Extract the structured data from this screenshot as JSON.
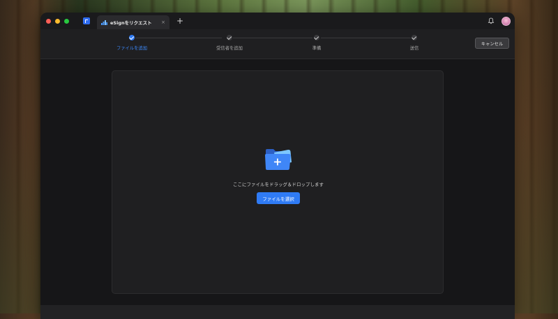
{
  "window": {
    "traffic_lights": [
      "#ff5f57",
      "#febc2e",
      "#28c840"
    ],
    "tab": {
      "title": "eSignをリクエスト",
      "close_glyph": "×"
    },
    "new_tab_glyph": "+"
  },
  "steps": [
    {
      "label": "ファイルを追加",
      "state": "active"
    },
    {
      "label": "受信者を追加",
      "state": "pending"
    },
    {
      "label": "準備",
      "state": "pending"
    },
    {
      "label": "送信",
      "state": "pending"
    }
  ],
  "cancel_label": "キャンセル",
  "dropzone": {
    "text": "ここにファイルをドラッグ＆ドロップします",
    "button_label": "ファイルを選択"
  },
  "colors": {
    "accent": "#2f7bf5",
    "active_step_text": "#3d8bff",
    "window_bg": "#1a1a1c"
  },
  "icons": [
    "app-icon",
    "esign-icon",
    "bell-icon",
    "avatar",
    "folder-add-icon",
    "check-icon"
  ]
}
